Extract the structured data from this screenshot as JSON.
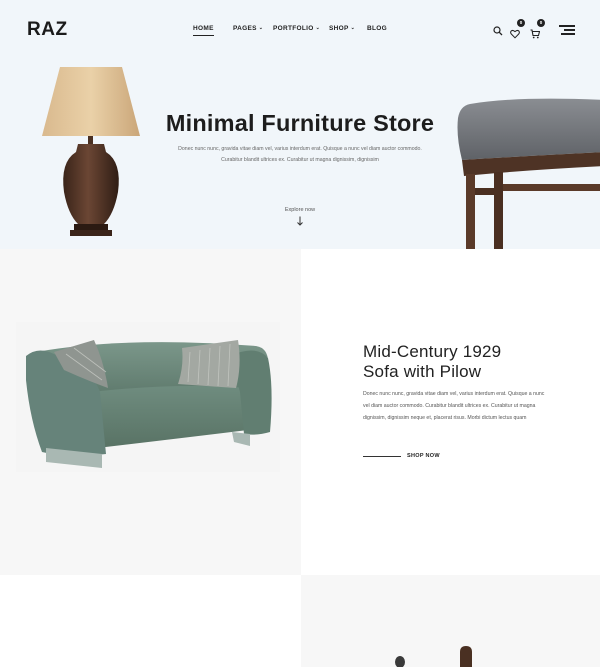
{
  "brand": {
    "logo": "RAZ"
  },
  "nav": {
    "items": [
      {
        "label": "HOME",
        "active": true,
        "has_dropdown": false
      },
      {
        "label": "PAGES",
        "active": false,
        "has_dropdown": true
      },
      {
        "label": "PORTFOLIO",
        "active": false,
        "has_dropdown": true
      },
      {
        "label": "SHOP",
        "active": false,
        "has_dropdown": true
      },
      {
        "label": "BLOG",
        "active": false,
        "has_dropdown": false
      }
    ],
    "caret": "⌄"
  },
  "header_icons": {
    "search": "search-icon",
    "wishlist": {
      "icon": "heart-icon",
      "count": "0"
    },
    "cart": {
      "icon": "cart-icon",
      "count": "0"
    },
    "menu": "hamburger-menu-icon"
  },
  "hero": {
    "title": "Minimal Furniture Store",
    "desc_line1": "Donec nunc nunc, gravida vitae diam vel, varius interdum erat. Quisque a nunc vel diam auctor commodo.",
    "desc_line2": "Curabitur blandit ultrices ex. Curabitur ut magna dignissim, dignissim",
    "explore": "Explore now"
  },
  "product": {
    "title_line1": "Mid-Century 1929",
    "title_line2": "Sofa with Pilow",
    "desc": "Donec nunc nunc, gravida vitae diam vel, varius interdum erat. Quisque a nunc vel diam auctor commodo. Curabitur blandit ultrices ex. Curabitur ut magna dignissim, dignissim neque et, placerat risus. Morbi dictum lectus quam",
    "cta": "SHOP NOW"
  },
  "colors": {
    "hero_bg": "#f1f6fa",
    "panel_bg": "#f7f7f7",
    "text_dark": "#222222",
    "sofa_green": "#6d8a7c"
  }
}
